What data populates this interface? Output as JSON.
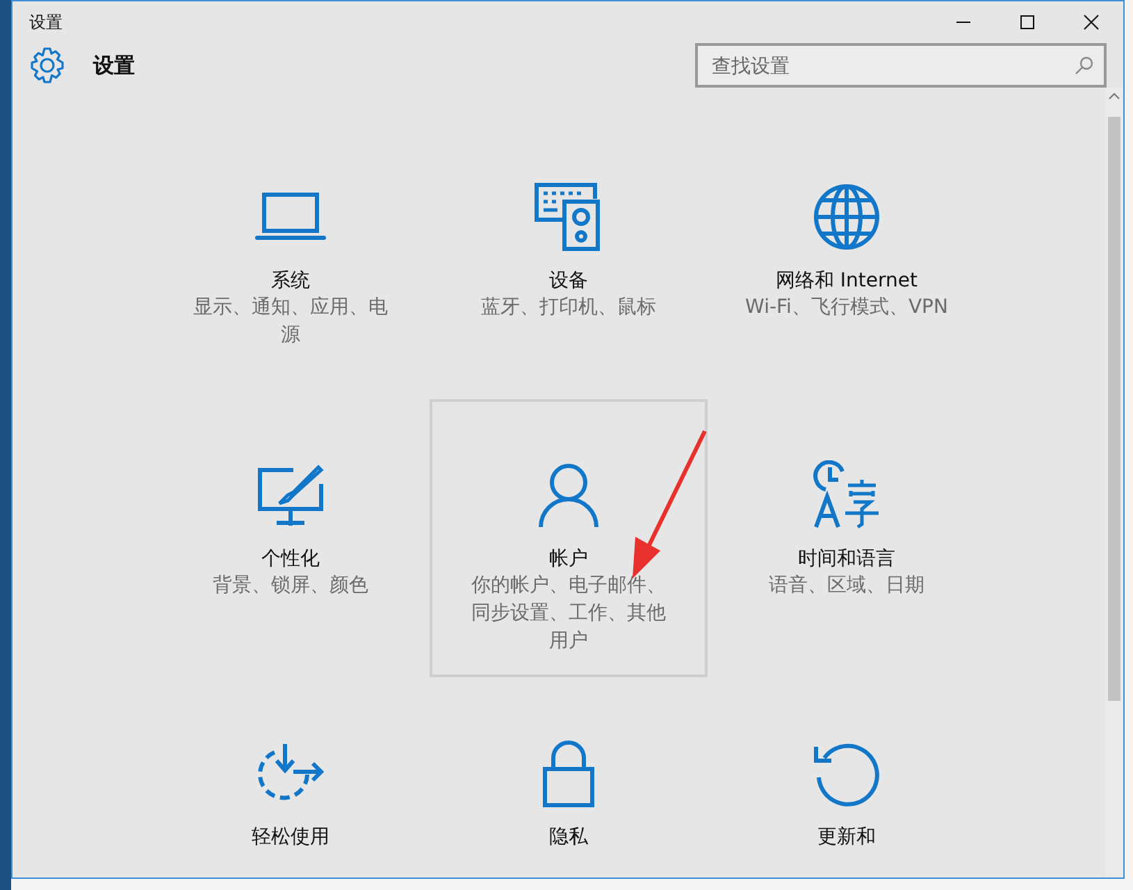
{
  "window": {
    "title": "设置"
  },
  "header": {
    "title": "设置"
  },
  "search": {
    "placeholder": "查找设置"
  },
  "categories": [
    {
      "kind": "system",
      "title": "系统",
      "subtitle": "显示、通知、应用、电源",
      "selected": false
    },
    {
      "kind": "devices",
      "title": "设备",
      "subtitle": "蓝牙、打印机、鼠标",
      "selected": false
    },
    {
      "kind": "network",
      "title": "网络和 Internet",
      "subtitle": "Wi-Fi、飞行模式、VPN",
      "selected": false
    },
    {
      "kind": "personalization",
      "title": "个性化",
      "subtitle": "背景、锁屏、颜色",
      "selected": false
    },
    {
      "kind": "accounts",
      "title": "帐户",
      "subtitle": "你的帐户、电子邮件、同步设置、工作、其他用户",
      "selected": true
    },
    {
      "kind": "time",
      "title": "时间和语言",
      "subtitle": "语音、区域、日期",
      "selected": false
    },
    {
      "kind": "ease",
      "title": "轻松使用",
      "selected": false
    },
    {
      "kind": "privacy",
      "title": "隐私",
      "selected": false
    },
    {
      "kind": "update",
      "title": "更新和",
      "selected": false
    }
  ]
}
